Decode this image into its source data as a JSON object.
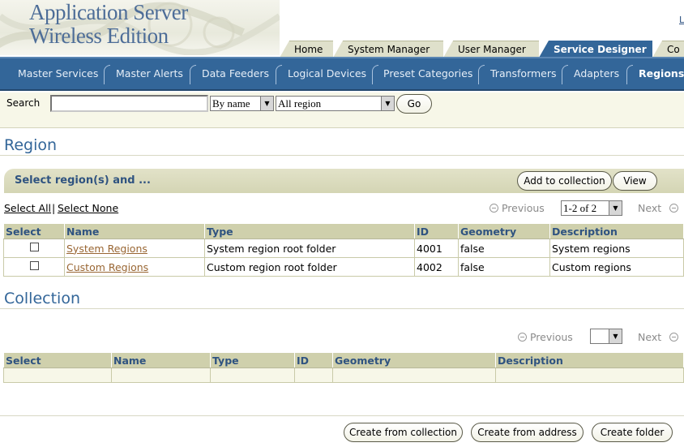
{
  "brand": {
    "line1": "Application Server",
    "line2": "Wireless Edition"
  },
  "corner_link": "L",
  "tabs": [
    {
      "label": "Home",
      "active": false
    },
    {
      "label": "System Manager",
      "active": false
    },
    {
      "label": "User Manager",
      "active": false
    },
    {
      "label": "Service Designer",
      "active": true
    },
    {
      "label": "Co",
      "active": false
    }
  ],
  "subnav": [
    {
      "label": "Master Services",
      "active": false
    },
    {
      "label": "Master Alerts",
      "active": false
    },
    {
      "label": "Data Feeders",
      "active": false
    },
    {
      "label": "Logical Devices",
      "active": false
    },
    {
      "label": "Preset Categories",
      "active": false
    },
    {
      "label": "Transformers",
      "active": false
    },
    {
      "label": "Adapters",
      "active": false
    },
    {
      "label": "Regions",
      "active": true
    }
  ],
  "search": {
    "label": "Search",
    "value": "",
    "by_selected": "By name",
    "scope_selected": "All region",
    "go_label": "Go"
  },
  "region": {
    "title": "Region",
    "action_title": "Select region(s) and ...",
    "add_to_collection_label": "Add to collection",
    "view_label": "View",
    "select_all_label": "Select All",
    "separator": "|",
    "select_none_label": "Select None",
    "pager": {
      "previous_label": "Previous",
      "range_selected": "1-2 of 2",
      "next_label": "Next"
    },
    "columns": [
      "Select",
      "Name",
      "Type",
      "ID",
      "Geometry",
      "Description"
    ],
    "rows": [
      {
        "name": "System Regions",
        "type": "System region root folder",
        "id": "4001",
        "geometry": "false",
        "description": "System regions"
      },
      {
        "name": "Custom Regions",
        "type": "Custom region root folder",
        "id": "4002",
        "geometry": "false",
        "description": "Custom regions"
      }
    ]
  },
  "collection": {
    "title": "Collection",
    "pager": {
      "previous_label": "Previous",
      "range_selected": "",
      "next_label": "Next"
    },
    "columns": [
      "Select",
      "Name",
      "Type",
      "ID",
      "Geometry",
      "Description"
    ]
  },
  "footer": {
    "create_from_collection_label": "Create from collection",
    "create_from_address_label": "Create from address",
    "create_folder_label": "Create folder"
  },
  "colors": {
    "accent": "#336699",
    "khaki": "#cfd0ac",
    "link_brown": "#996633"
  }
}
